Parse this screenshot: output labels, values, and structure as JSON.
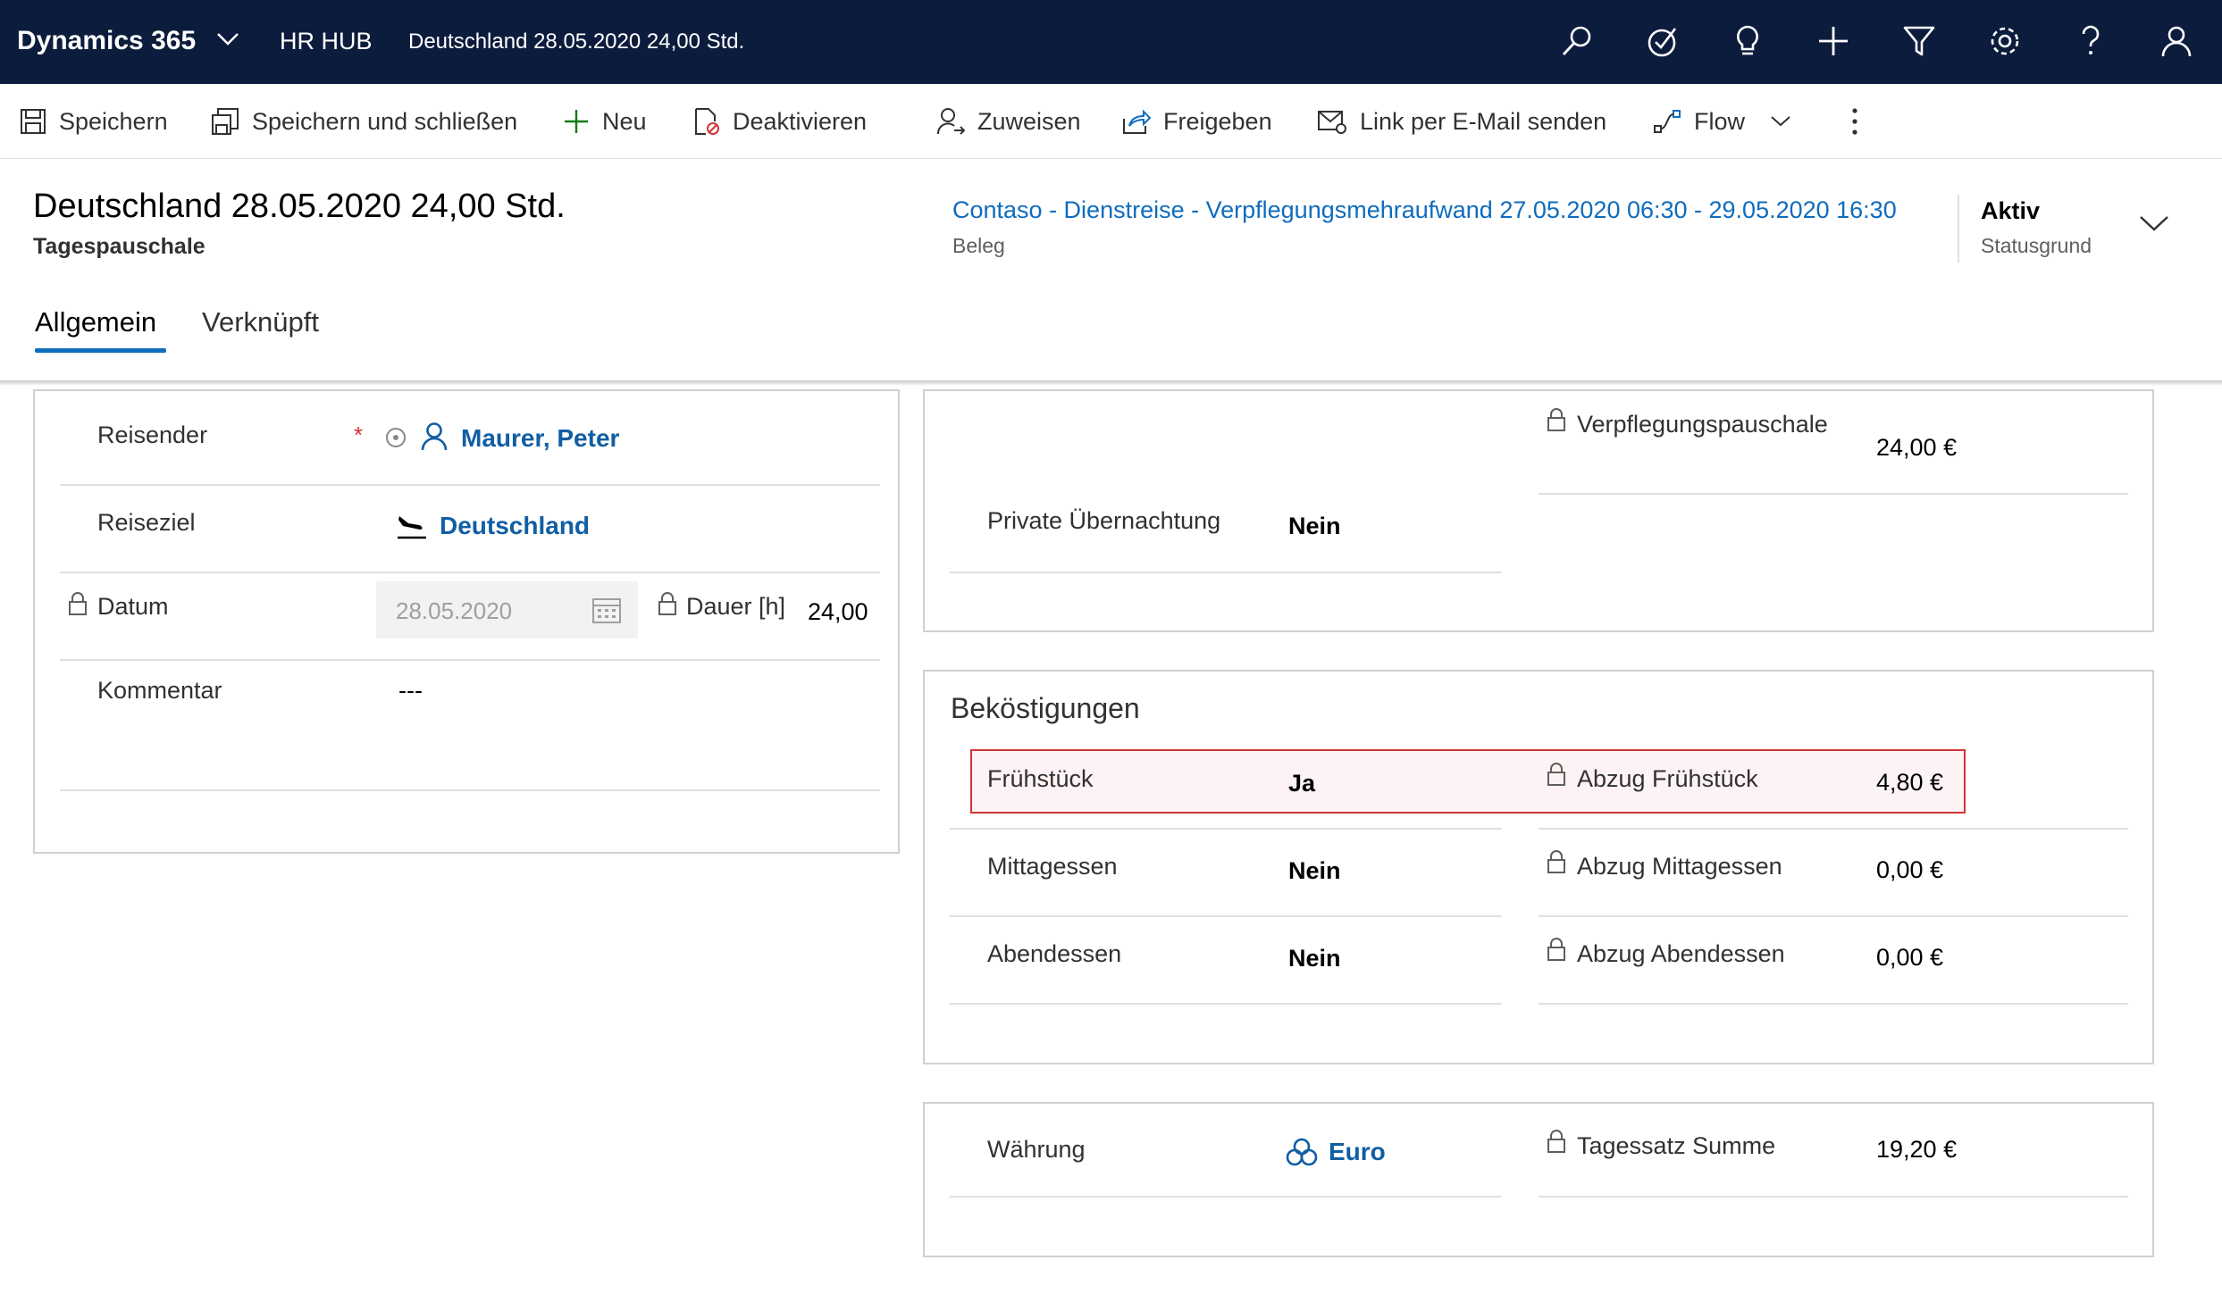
{
  "topbar": {
    "brand": "Dynamics 365",
    "app_name": "HR HUB",
    "record": "Deutschland 28.05.2020 24,00 Std.",
    "icons": [
      "search-icon",
      "task-icon",
      "lightbulb-icon",
      "plus-icon",
      "filter-icon",
      "gear-icon",
      "help-icon",
      "user-icon"
    ]
  },
  "commands": {
    "save": "Speichern",
    "save_close": "Speichern und schließen",
    "new": "Neu",
    "deactivate": "Deaktivieren",
    "assign": "Zuweisen",
    "share": "Freigeben",
    "email_link": "Link per E-Mail senden",
    "flow": "Flow"
  },
  "header": {
    "title": "Deutschland 28.05.2020 24,00 Std.",
    "entity": "Tagespauschale",
    "lookup_value": "Contaso - Dienstreise - Verpflegungsmehraufwand 27.05.2020 06:30 - 29.05.2020 16:30",
    "lookup_label": "Beleg",
    "status_value": "Aktiv",
    "status_label": "Statusgrund"
  },
  "tabs": {
    "general": "Allgemein",
    "related": "Verknüpft"
  },
  "left": {
    "traveler_label": "Reisender",
    "required_mark": "*",
    "traveler_value": "Maurer, Peter",
    "destination_label": "Reiseziel",
    "destination_value": "Deutschland",
    "date_label": "Datum",
    "date_value": "28.05.2020",
    "duration_label": "Dauer [h]",
    "duration_value": "24,00",
    "comment_label": "Kommentar",
    "comment_value": "---"
  },
  "right_top": {
    "allowance_label": "Verpflegungspauschale",
    "allowance_value": "24,00 €",
    "private_label": "Private Übernachtung",
    "private_value": "Nein"
  },
  "meals": {
    "title": "Beköstigungen",
    "breakfast_label": "Frühstück",
    "breakfast_value": "Ja",
    "breakfast_deduction_label": "Abzug Frühstück",
    "breakfast_deduction_value": "4,80 €",
    "lunch_label": "Mittagessen",
    "lunch_value": "Nein",
    "lunch_deduction_label": "Abzug Mittagessen",
    "lunch_deduction_value": "0,00 €",
    "dinner_label": "Abendessen",
    "dinner_value": "Nein",
    "dinner_deduction_label": "Abzug Abendessen",
    "dinner_deduction_value": "0,00 €"
  },
  "totals": {
    "currency_label": "Währung",
    "currency_value": "Euro",
    "daily_sum_label": "Tagessatz Summe",
    "daily_sum_value": "19,20 €"
  },
  "colors": {
    "topbar_bg": "#0c1c3c",
    "link": "#0f6cbd",
    "highlight_border": "#d13438"
  }
}
